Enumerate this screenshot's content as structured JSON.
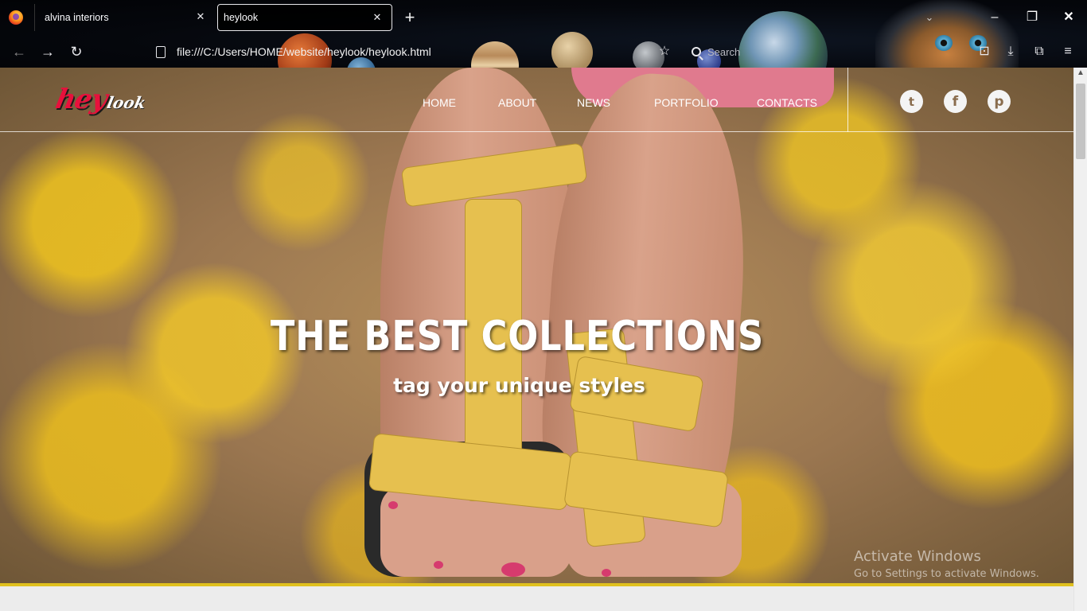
{
  "browser": {
    "tabs": [
      {
        "label": "alvina interiors",
        "active": false
      },
      {
        "label": "heylook",
        "active": true
      }
    ],
    "url": "file:///C:/Users/HOME/website/heylook/heylook.html",
    "search_placeholder": "Search",
    "icons": {
      "back": "arrow-left-icon",
      "forward": "arrow-right-icon",
      "reload": "reload-icon",
      "bookmark": "star-icon",
      "downloads": "download-icon",
      "extensions": "puzzle-icon",
      "menu": "hamburger-icon"
    }
  },
  "site": {
    "logo": {
      "part1": "hey",
      "part2": "look"
    },
    "nav": [
      "HOME",
      "ABOUT",
      "NEWS",
      "PORTFOLIO",
      "CONTACTS"
    ],
    "social": [
      {
        "name": "twitter-icon",
        "glyph": "t"
      },
      {
        "name": "facebook-icon",
        "glyph": "f"
      },
      {
        "name": "pinterest-icon",
        "glyph": "p"
      }
    ],
    "hero": {
      "title": "THE BEST COLLECTIONS",
      "subtitle": "tag your unique styles"
    }
  },
  "os_watermark": {
    "line1": "Activate Windows",
    "line2": "Go to Settings to activate Windows."
  },
  "colors": {
    "logo_accent": "#e8103c",
    "hero_accent": "#e0c01e",
    "chrome_bg": "#05070c"
  }
}
